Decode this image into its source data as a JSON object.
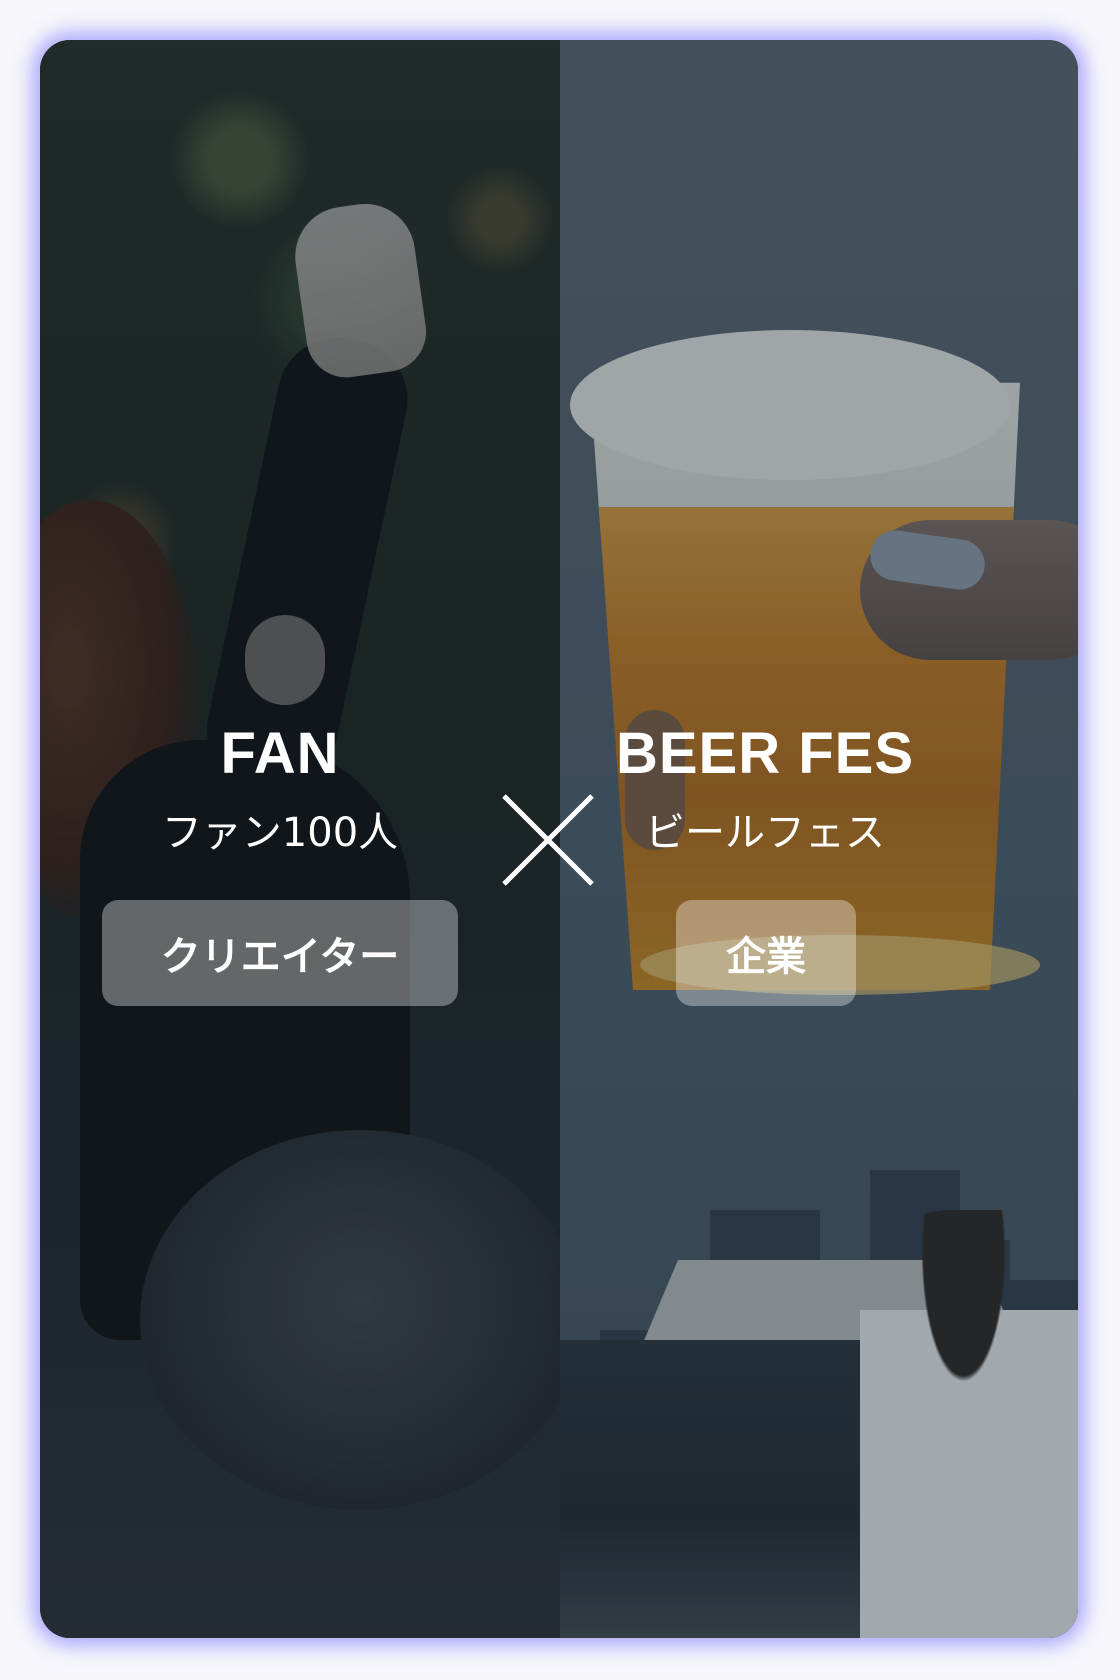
{
  "left": {
    "title": "FAN",
    "subtitle": "ファン100人",
    "tag": "クリエイター"
  },
  "right": {
    "title": "BEER FES",
    "subtitle": "ビールフェス",
    "tag": "企業"
  },
  "separator_icon": "cross-icon",
  "colors": {
    "glow": "#7a6cff",
    "text": "#ffffff"
  }
}
